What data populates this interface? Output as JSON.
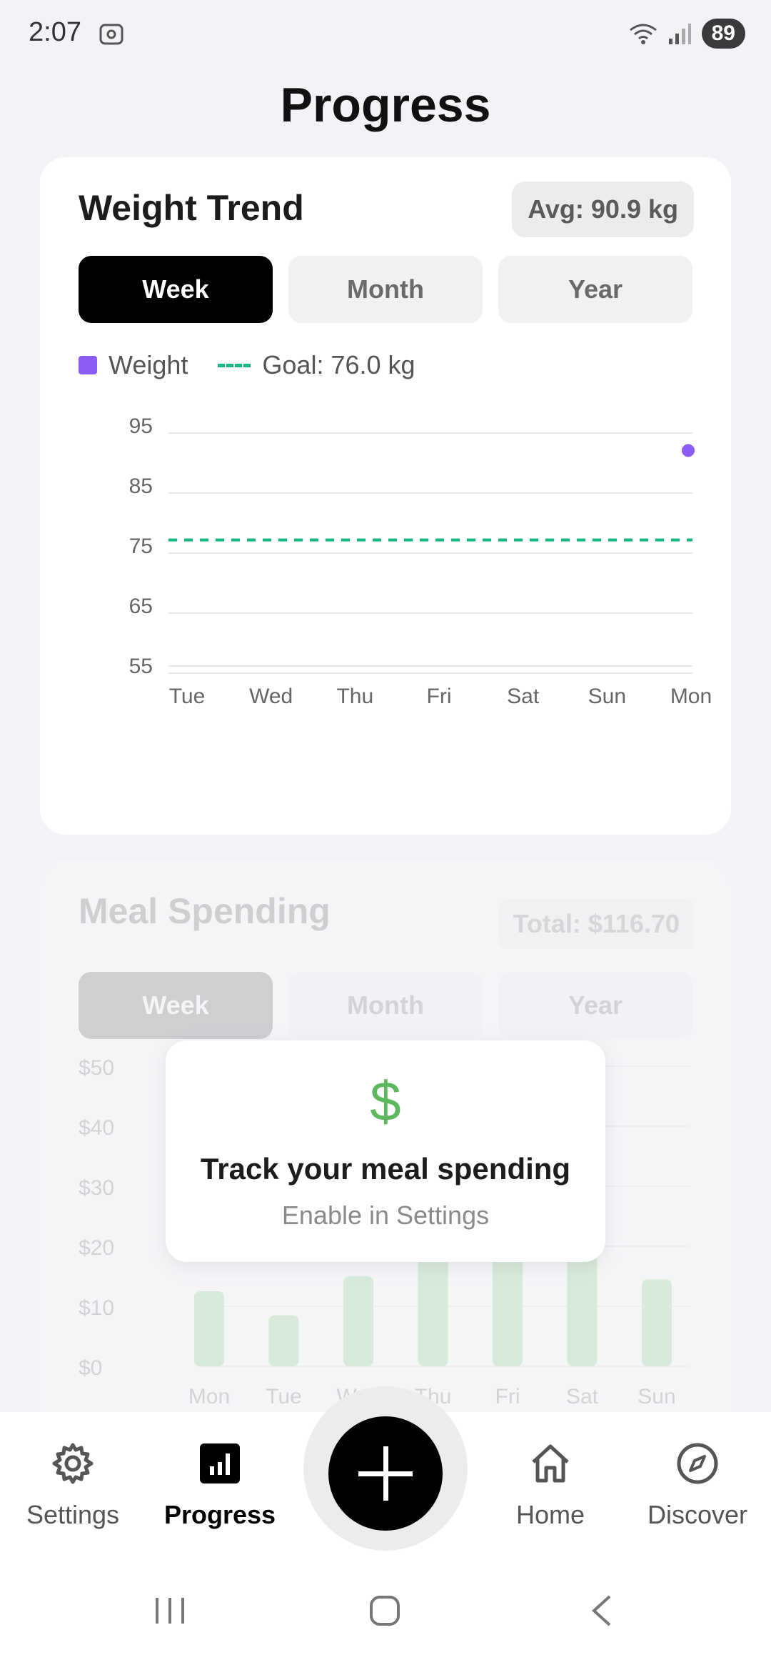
{
  "status_bar": {
    "time": "2:07",
    "battery": "89"
  },
  "page": {
    "title": "Progress"
  },
  "weight_card": {
    "title": "Weight Trend",
    "avg": "Avg: 90.9 kg",
    "tabs": [
      "Week",
      "Month",
      "Year"
    ],
    "active_tab": "Week",
    "legend_weight": "Weight",
    "legend_goal": "Goal: 76.0 kg",
    "weight_color": "#8b5cf6",
    "goal_color": "#10b981"
  },
  "meal_card": {
    "title": "Meal Spending",
    "total": "Total: $116.70",
    "tabs": [
      "Week",
      "Month",
      "Year"
    ],
    "active_tab": "Week"
  },
  "overlay": {
    "icon": "$",
    "title": "Track your meal spending",
    "subtitle": "Enable in Settings"
  },
  "bottom_nav": {
    "settings": "Settings",
    "progress": "Progress",
    "home": "Home",
    "discover": "Discover",
    "active": "Progress"
  },
  "chart_data": [
    {
      "type": "line",
      "categories": [
        "Tue",
        "Wed",
        "Thu",
        "Fri",
        "Sat",
        "Sun",
        "Mon"
      ],
      "ylim": [
        55,
        95
      ],
      "yticks": [
        95,
        85,
        75,
        65,
        55
      ],
      "series": [
        {
          "name": "Weight",
          "values": [
            null,
            null,
            null,
            null,
            null,
            null,
            90.9
          ]
        },
        {
          "name": "Goal: 76.0 kg",
          "values": [
            76,
            76,
            76,
            76,
            76,
            76,
            76
          ]
        }
      ],
      "grid": true,
      "legend": "top-left"
    },
    {
      "type": "bar",
      "categories": [
        "Mon",
        "Tue",
        "Wed",
        "Thu",
        "Fri",
        "Sat",
        "Sun"
      ],
      "yticks": [
        "$50",
        "$40",
        "$30",
        "$20",
        "$10",
        "$0"
      ],
      "ylim": [
        0,
        50
      ],
      "values": [
        12.5,
        8.5,
        15,
        21,
        21,
        21,
        14.5
      ]
    }
  ]
}
